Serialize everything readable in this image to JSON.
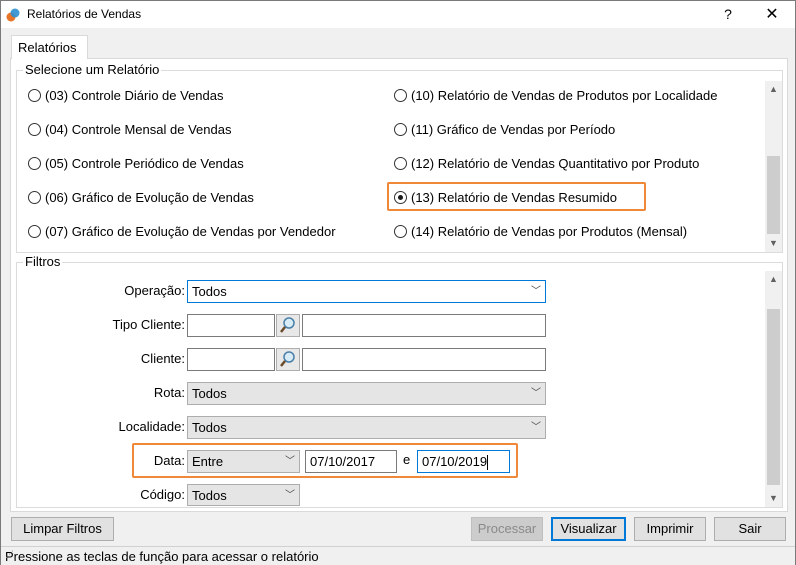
{
  "window": {
    "title": "Relatórios de Vendas",
    "help_label": "?",
    "close_label": "✕"
  },
  "tab": {
    "label": "Relatórios"
  },
  "report_group": {
    "title": "Selecione um Relatório",
    "left_options": [
      "(03) Controle Diário de Vendas",
      "(04) Controle Mensal de Vendas",
      "(05) Controle Periódico de Vendas",
      "(06) Gráfico de Evolução de Vendas",
      "(07) Gráfico de Evolução de Vendas por Vendedor"
    ],
    "right_options": [
      "(10) Relatório de Vendas de Produtos por Localidade",
      "(11) Gráfico de Vendas por Período",
      "(12) Relatório de Vendas Quantitativo por Produto",
      "(13) Relatório de Vendas Resumido",
      "(14) Relatório de Vendas por Produtos (Mensal)"
    ],
    "selected": "(13) Relatório de Vendas Resumido"
  },
  "filters": {
    "title": "Filtros",
    "operacao": {
      "label": "Operação:",
      "value": "Todos"
    },
    "tipo_cliente": {
      "label": "Tipo Cliente:",
      "code": "",
      "description": ""
    },
    "cliente": {
      "label": "Cliente:",
      "code": "",
      "description": ""
    },
    "rota": {
      "label": "Rota:",
      "value": "Todos"
    },
    "localidade": {
      "label": "Localidade:",
      "value": "Todos"
    },
    "data": {
      "label": "Data:",
      "mode": "Entre",
      "from": "07/10/2017",
      "separator": "e",
      "to": "07/10/2019"
    },
    "codigo": {
      "label": "Código:",
      "value": "Todos"
    }
  },
  "buttons": {
    "clear": "Limpar Filtros",
    "process": "Processar",
    "view": "Visualizar",
    "print": "Imprimir",
    "exit": "Sair"
  },
  "status": {
    "text": "Pressione as teclas de função para acessar o relatório"
  },
  "colors": {
    "highlight": "#f0883a",
    "focus": "#0078d7"
  }
}
